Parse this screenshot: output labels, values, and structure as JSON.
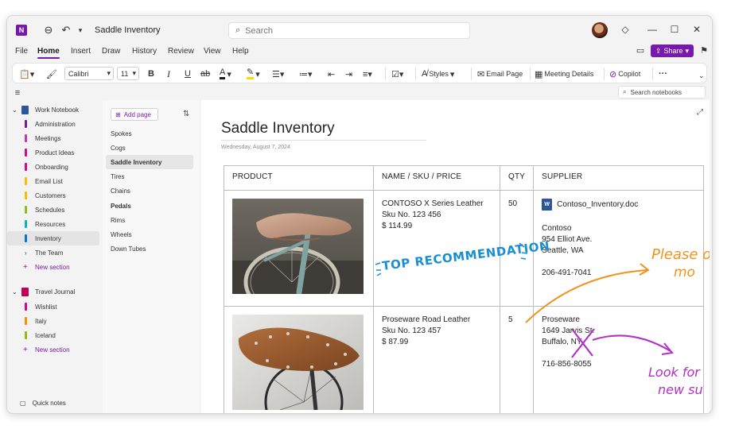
{
  "window": {
    "title": "Saddle Inventory"
  },
  "search": {
    "placeholder": "Search"
  },
  "menu": {
    "items": [
      "File",
      "Home",
      "Insert",
      "Draw",
      "History",
      "Review",
      "View",
      "Help"
    ],
    "active": "Home"
  },
  "share": {
    "label": "Share"
  },
  "ribbon": {
    "font_name": "Calibri",
    "font_size": "11",
    "bold": "B",
    "italic": "I",
    "underline": "U",
    "strike": "ab",
    "styles_label": "Styles",
    "email_page_label": "Email Page",
    "meeting_details_label": "Meeting Details",
    "copilot_label": "Copilot",
    "more_label": "···"
  },
  "search_notebooks": {
    "placeholder": "Search notebooks"
  },
  "notebooks": [
    {
      "name": "Work Notebook",
      "color": "#2b579a",
      "sections": [
        {
          "name": "Administration",
          "color": "#7719aa"
        },
        {
          "name": "Meetings",
          "color": "#c239b3"
        },
        {
          "name": "Product Ideas",
          "color": "#e3008c"
        },
        {
          "name": "Onboarding",
          "color": "#e3008c"
        },
        {
          "name": "Email List",
          "color": "#ffb900"
        },
        {
          "name": "Customers",
          "color": "#ffb900"
        },
        {
          "name": "Schedules",
          "color": "#8cbd18"
        },
        {
          "name": "Resources",
          "color": "#00b7c3"
        },
        {
          "name": "Inventory",
          "color": "#0078d4"
        }
      ],
      "group": "The Team",
      "new_section": "New section"
    },
    {
      "name": "Travel Journal",
      "color": "#c30052",
      "sections": [
        {
          "name": "Wishlist",
          "color": "#e3008c"
        },
        {
          "name": "Italy",
          "color": "#ff8c00"
        },
        {
          "name": "Iceland",
          "color": "#8cbd18"
        }
      ],
      "new_section": "New section"
    }
  ],
  "quick_notes": "Quick notes",
  "pages": {
    "add_label": "Add page",
    "items": [
      "Spokes",
      "Cogs",
      "Saddle Inventory",
      "Tires",
      "Chains",
      "Pedals",
      "Rims",
      "Wheels",
      "Down Tubes"
    ],
    "selected": "Saddle Inventory"
  },
  "page": {
    "title": "Saddle Inventory",
    "date": "Wednesday, August 7, 2024"
  },
  "table": {
    "headers": [
      "PRODUCT",
      "NAME  /  SKU  /  PRICE",
      "QTY",
      "SUPPLIER"
    ],
    "rows": [
      {
        "name": "CONTOSO X Series Leather",
        "sku": "Sku No. 123 456",
        "price": "$ 114.99",
        "qty": "50",
        "attachment": "Contoso_Inventory.doc",
        "supplier_name": "Contoso",
        "address1": "954 Elliot Ave.",
        "address2": "Seattle, WA",
        "phone": "206-491-7041"
      },
      {
        "name": "Proseware Road Leather",
        "sku": "Sku No. 123 457",
        "price": "$ 87.99",
        "qty": "5",
        "supplier_name": "Proseware",
        "address1": "1649 Jarvis St.",
        "address2": "Buffalo, NY",
        "phone": "716-856-8055"
      }
    ]
  },
  "ink": {
    "top_recommendation": "TOP RECOMMENDATION",
    "please_line1": "Please o",
    "please_line2": "mo",
    "look_line1": "Look for",
    "look_line2": "new su",
    "blue": "#1a8fd0",
    "orange": "#f0921e",
    "magenta": "#b42fc8"
  }
}
